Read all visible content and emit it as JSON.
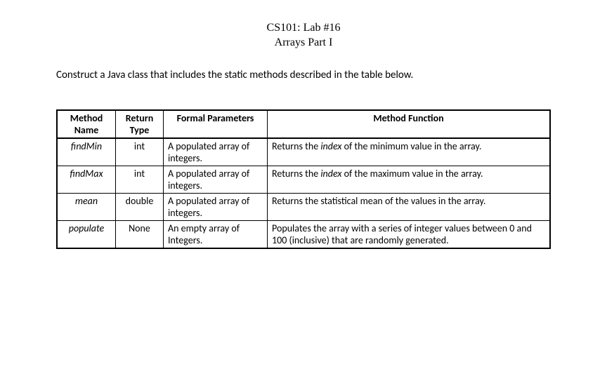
{
  "header": {
    "line1": "CS101: Lab #16",
    "line2": "Arrays Part I"
  },
  "instruction": "Construct a Java class that includes the static methods described in the table below.",
  "table": {
    "headers": {
      "name": "Method Name",
      "return": "Return Type",
      "params": "Formal Parameters",
      "function": "Method Function"
    },
    "rows": [
      {
        "name": "findMin",
        "return": "int",
        "params": "A populated array of integers.",
        "function_html": "Returns the <em>index</em> of the minimum value in the array."
      },
      {
        "name": "findMax",
        "return": "int",
        "params": "A populated array of integers.",
        "function_html": "Returns the <em>index</em> of the maximum value in the array."
      },
      {
        "name": "mean",
        "return": "double",
        "params": "A populated array of integers.",
        "function_html": "Returns the statistical mean of the values in the array."
      },
      {
        "name": "populate",
        "return": "None",
        "params": "An empty array of Integers.",
        "function_html": "Populates the array with a series of integer values between 0 and 100 (inclusive) that are randomly generated."
      }
    ]
  }
}
